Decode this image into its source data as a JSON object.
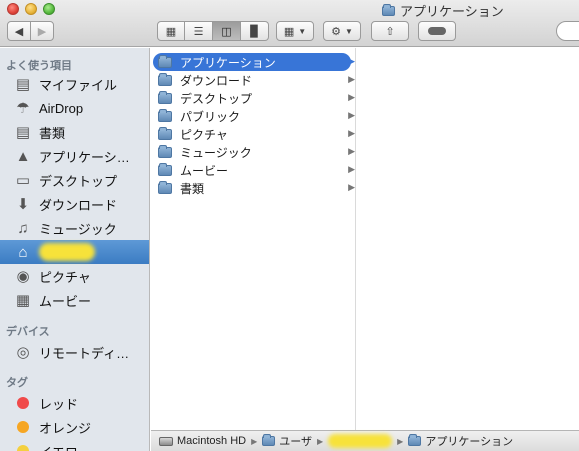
{
  "window": {
    "title": "アプリケーション"
  },
  "toolbar": {
    "back_icon": "chevron-left-icon",
    "forward_icon": "chevron-right-icon",
    "view_modes": [
      "icon-view",
      "list-view",
      "column-view",
      "coverflow-view"
    ],
    "active_view": "column-view",
    "arrange_icon": "grid-icon",
    "action_icon": "gear-icon",
    "share_icon": "share-icon",
    "tag_icon": "tag-toggle-icon"
  },
  "sidebar": {
    "favorites_header": "よく使う項目",
    "favorites": [
      {
        "label": "マイファイル",
        "icon": "all-files-icon"
      },
      {
        "label": "AirDrop",
        "icon": "airdrop-icon"
      },
      {
        "label": "書類",
        "icon": "documents-icon"
      },
      {
        "label": "アプリケーシ…",
        "icon": "applications-icon"
      },
      {
        "label": "デスクトップ",
        "icon": "desktop-icon"
      },
      {
        "label": "ダウンロード",
        "icon": "downloads-icon"
      },
      {
        "label": "ミュージック",
        "icon": "music-icon"
      },
      {
        "label": "",
        "icon": "home-icon"
      },
      {
        "label": "ピクチャ",
        "icon": "pictures-icon"
      },
      {
        "label": "ムービー",
        "icon": "movies-icon"
      }
    ],
    "devices_header": "デバイス",
    "devices": [
      {
        "label": "リモートディ…",
        "icon": "remote-disc-icon"
      }
    ],
    "tags_header": "タグ",
    "tags": [
      {
        "label": "レッド",
        "color": "#f04a4a"
      },
      {
        "label": "オレンジ",
        "color": "#f6a623"
      },
      {
        "label": "イエロー",
        "color": "#f4d03f"
      }
    ]
  },
  "columns": {
    "first": [
      {
        "label": "アプリケーション",
        "selected": true
      },
      {
        "label": "ダウンロード",
        "selected": false
      },
      {
        "label": "デスクトップ",
        "selected": false
      },
      {
        "label": "パブリック",
        "selected": false
      },
      {
        "label": "ピクチャ",
        "selected": false
      },
      {
        "label": "ミュージック",
        "selected": false
      },
      {
        "label": "ムービー",
        "selected": false
      },
      {
        "label": "書類",
        "selected": false
      }
    ]
  },
  "pathbar": {
    "disk": "Macintosh HD",
    "users": "ユーザ",
    "current": "アプリケーション"
  },
  "colors": {
    "selection": "#3875d7",
    "sidebar_bg": "#e1e6ec",
    "sidebar_selected": "#3b7cc3"
  }
}
